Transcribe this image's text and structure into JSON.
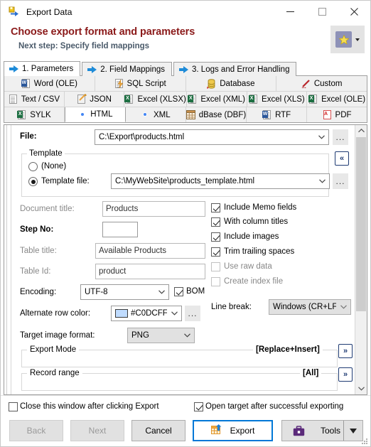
{
  "window": {
    "title": "Export Data",
    "icon": "export-data-icon",
    "controls": {
      "minimize": "minimize-icon",
      "maximize": "maximize-icon",
      "close": "close-icon"
    }
  },
  "header": {
    "title": "Choose export format and parameters",
    "subtitle": "Next step: Specify field mappings",
    "favorites_button": {
      "icon": "star-icon",
      "dropdown": "chevron-down-icon"
    }
  },
  "step_tabs": [
    {
      "label": "1. Parameters",
      "active": true
    },
    {
      "label": "2. Field Mappings",
      "active": false
    },
    {
      "label": "3. Logs and Error Handling",
      "active": false
    }
  ],
  "format_tabs": {
    "row1": [
      {
        "label": "Word (OLE)",
        "icon": "word-icon",
        "active": false
      },
      {
        "label": "SQL Script",
        "icon": "sql-script-icon",
        "active": false
      },
      {
        "label": "Database",
        "icon": "database-icon",
        "active": false
      },
      {
        "label": "Custom",
        "icon": "custom-pencil-icon",
        "active": false
      }
    ],
    "row2": [
      {
        "label": "Text / CSV",
        "icon": "text-file-icon",
        "active": false
      },
      {
        "label": "JSON",
        "icon": "json-icon",
        "active": false
      },
      {
        "label": "Excel (XLSX)",
        "icon": "excel-icon",
        "active": false
      },
      {
        "label": "Excel (XML)",
        "icon": "excel-icon",
        "active": false
      },
      {
        "label": "Excel (XLS)",
        "icon": "excel-icon",
        "active": false
      },
      {
        "label": "Excel (OLE)",
        "icon": "excel-icon",
        "active": false
      }
    ],
    "row3": [
      {
        "label": "SYLK",
        "icon": "sylk-icon",
        "active": false
      },
      {
        "label": "HTML",
        "icon": "chrome-icon",
        "active": true
      },
      {
        "label": "XML",
        "icon": "chrome-icon",
        "active": false
      },
      {
        "label": "dBase (DBF)",
        "icon": "dbase-icon",
        "active": false
      },
      {
        "label": "RTF",
        "icon": "word-icon",
        "active": false
      },
      {
        "label": "PDF",
        "icon": "pdf-icon",
        "active": false
      }
    ]
  },
  "form": {
    "file_label": "File:",
    "file_value": "C:\\Export\\products.html",
    "file_browse": "...",
    "collapse_button": "«",
    "template": {
      "group_label": "Template",
      "none_label": "(None)",
      "none_selected": false,
      "file_label": "Template file:",
      "file_selected": true,
      "file_value": "C:\\MyWebSite\\products_template.html",
      "browse": "..."
    },
    "document_title_label": "Document title:",
    "document_title_value": "Products",
    "step_no_label": "Step No:",
    "step_no_value": "",
    "table_title_label": "Table title:",
    "table_title_value": "Available Products",
    "table_id_label": "Table Id:",
    "table_id_value": "product",
    "encoding_label": "Encoding:",
    "encoding_value": "UTF-8",
    "bom_label": "BOM",
    "bom_checked": true,
    "alternate_row_color_label": "Alternate row color:",
    "alternate_row_color_value": "#C0DCFF",
    "alternate_row_color_swatch": "#C0DCFF",
    "alternate_row_color_browse": "...",
    "target_image_format_label": "Target image format:",
    "target_image_format_value": "PNG",
    "line_break_label": "Line break:",
    "line_break_value": "Windows (CR+LF)",
    "checkboxes": [
      {
        "label": "Include Memo fields",
        "checked": true,
        "enabled": true
      },
      {
        "label": "With column titles",
        "checked": true,
        "enabled": true
      },
      {
        "label": "Include images",
        "checked": true,
        "enabled": true
      },
      {
        "label": "Trim trailing spaces",
        "checked": true,
        "enabled": true
      },
      {
        "label": "Use raw data",
        "checked": false,
        "enabled": false
      },
      {
        "label": "Create index file",
        "checked": false,
        "enabled": false
      }
    ],
    "sections": [
      {
        "label": "Export Mode",
        "value": "[Replace+Insert]",
        "expand": "»"
      },
      {
        "label": "Record range",
        "value": "[All]",
        "expand": "»"
      }
    ]
  },
  "footer": {
    "close_window_label": "Close this window after clicking Export",
    "close_window_checked": false,
    "open_target_label": "Open target after successful exporting",
    "open_target_checked": true,
    "buttons": {
      "back": "Back",
      "next": "Next",
      "cancel": "Cancel",
      "export": "Export",
      "tools": "Tools"
    }
  }
}
